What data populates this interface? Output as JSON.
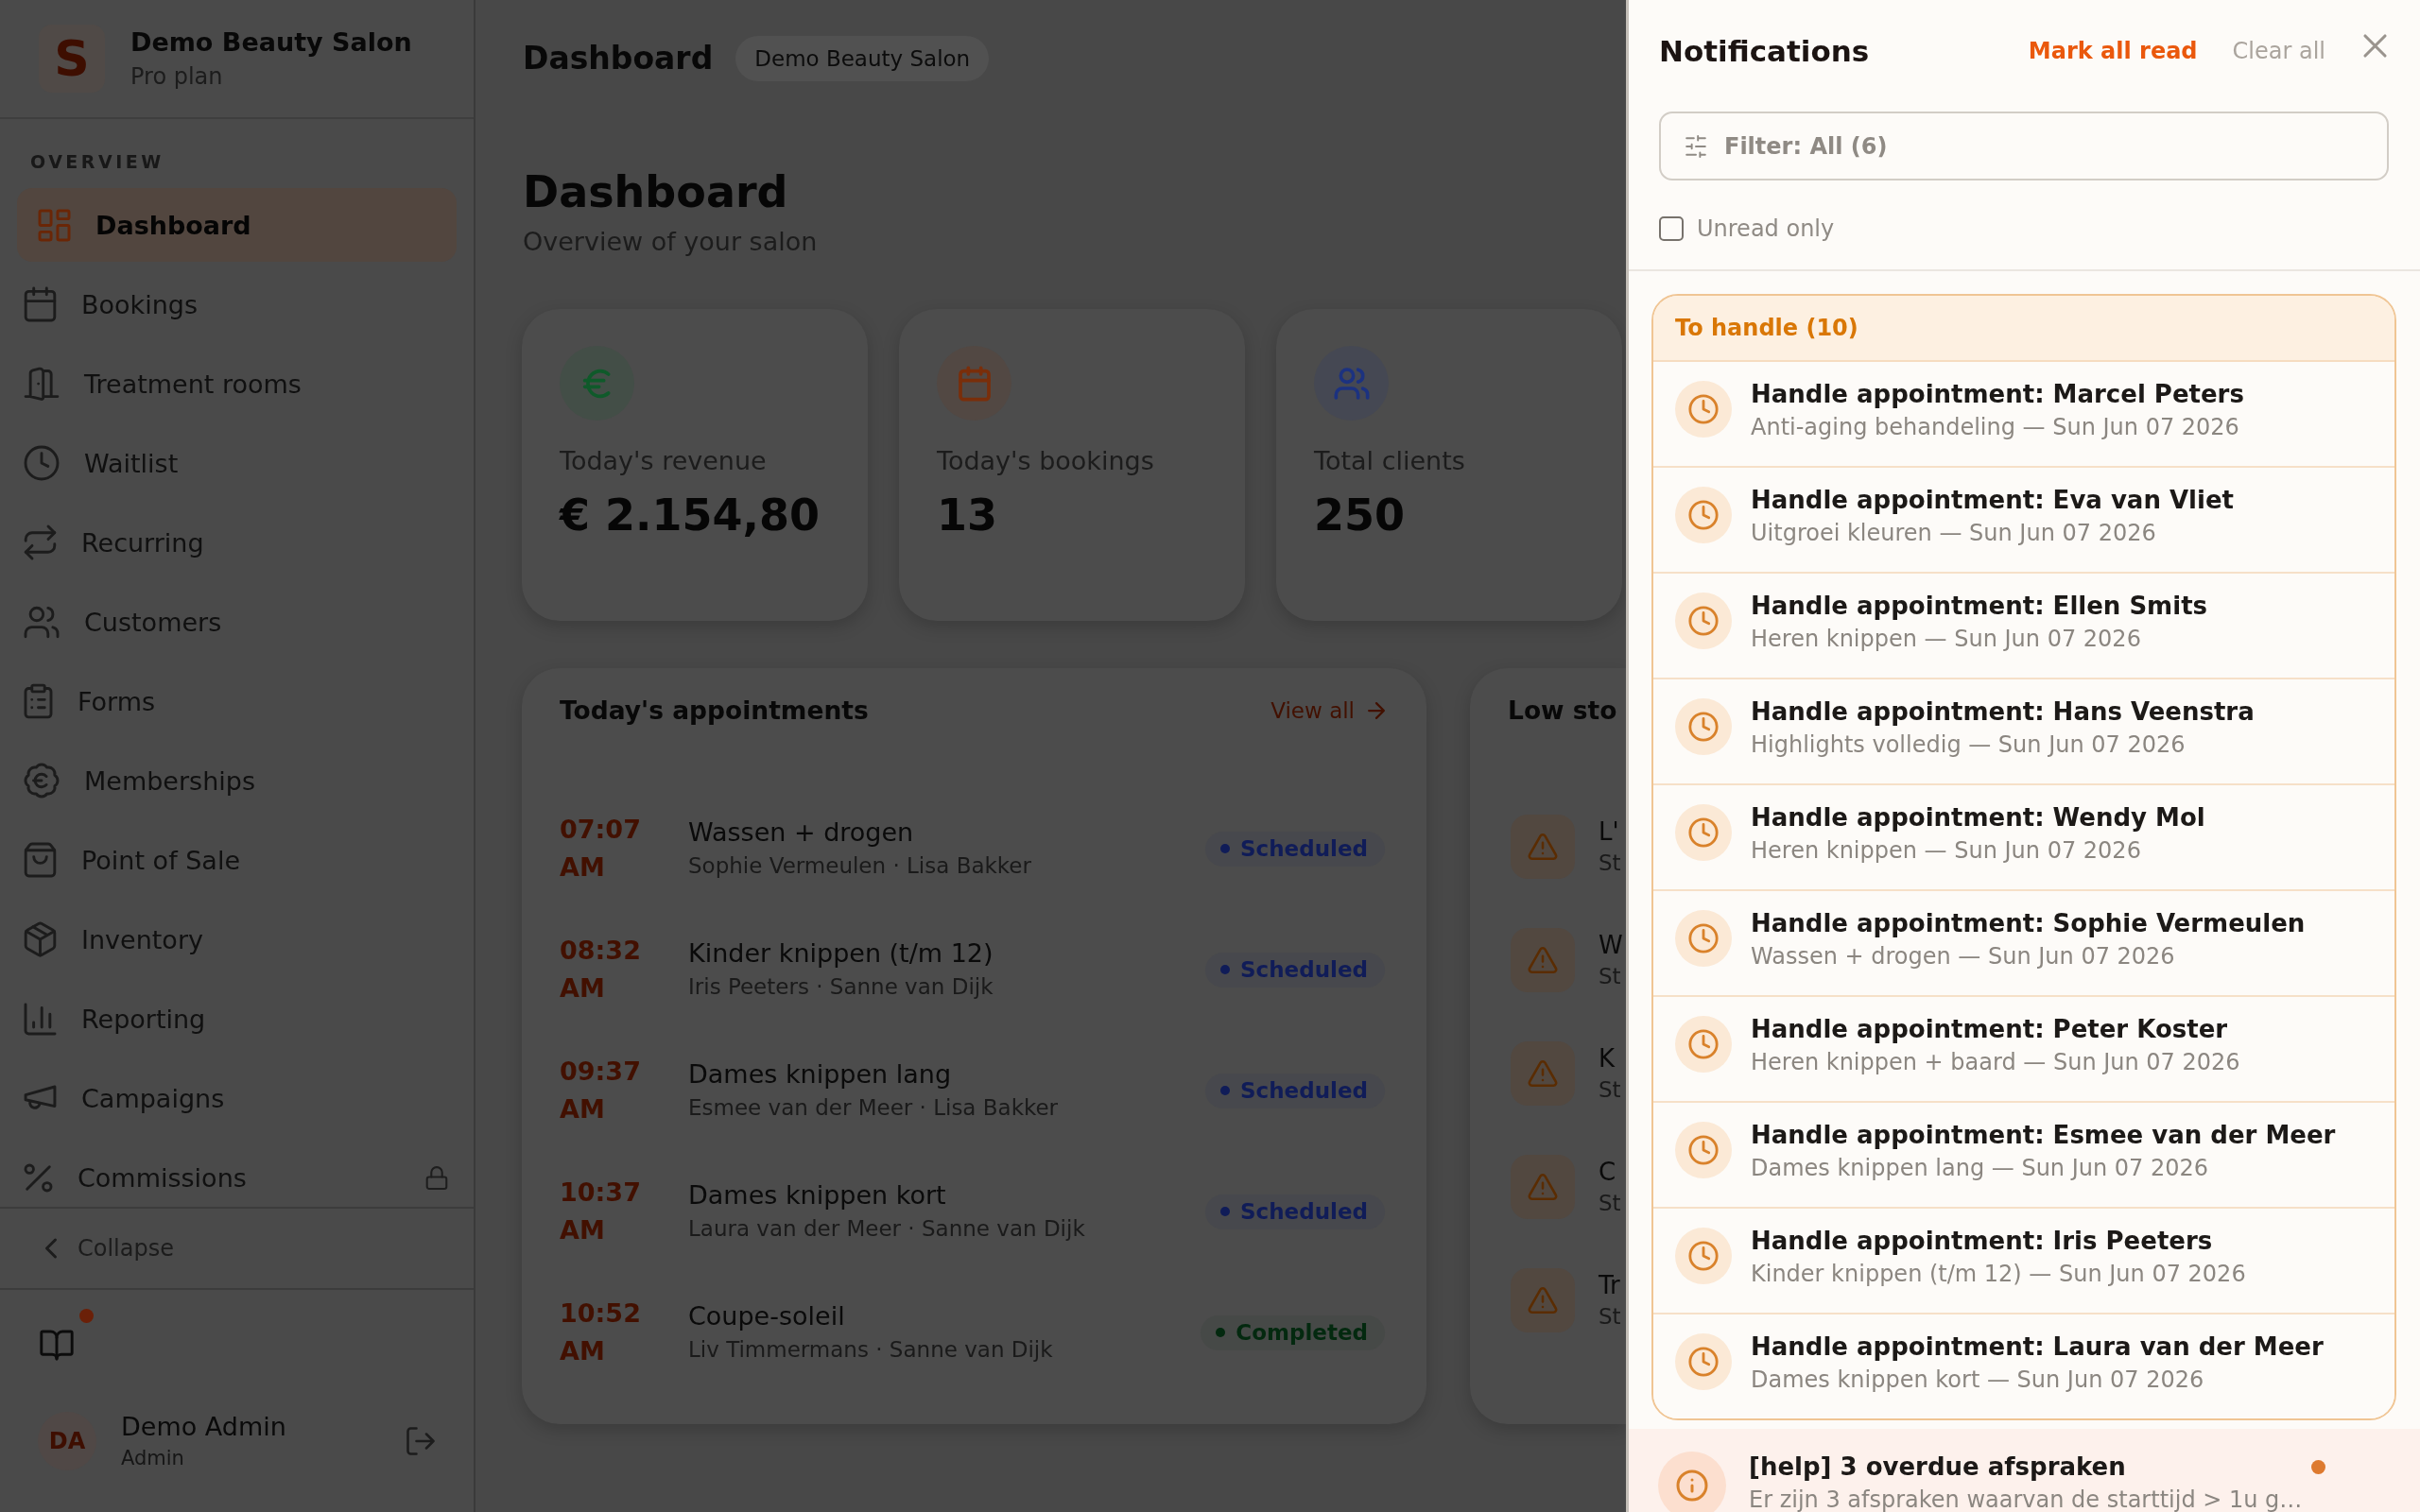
{
  "sidebar": {
    "brand": {
      "logo": "S",
      "name": "Demo Beauty Salon",
      "plan": "Pro plan"
    },
    "section": "OVERVIEW",
    "items": [
      {
        "label": "Dashboard",
        "selected": true,
        "locked": false
      },
      {
        "label": "Bookings",
        "selected": false,
        "locked": false
      },
      {
        "label": "Treatment rooms",
        "selected": false,
        "locked": false
      },
      {
        "label": "Waitlist",
        "selected": false,
        "locked": false
      },
      {
        "label": "Recurring",
        "selected": false,
        "locked": false
      },
      {
        "label": "Customers",
        "selected": false,
        "locked": false
      },
      {
        "label": "Forms",
        "selected": false,
        "locked": false
      },
      {
        "label": "Memberships",
        "selected": false,
        "locked": false
      },
      {
        "label": "Point of Sale",
        "selected": false,
        "locked": false
      },
      {
        "label": "Inventory",
        "selected": false,
        "locked": false
      },
      {
        "label": "Reporting",
        "selected": false,
        "locked": false
      },
      {
        "label": "Campaigns",
        "selected": false,
        "locked": false
      },
      {
        "label": "Commissions",
        "selected": false,
        "locked": true
      }
    ],
    "collapse": "Collapse",
    "help": {
      "unread": true
    },
    "user": {
      "initials": "DA",
      "name": "Demo Admin",
      "role": "Admin"
    }
  },
  "header": {
    "title": "Dashboard",
    "salon": "Demo Beauty Salon"
  },
  "page": {
    "title": "Dashboard",
    "subtitle": "Overview of your salon"
  },
  "stats": [
    {
      "label": "Today's revenue",
      "value": "€ 2.154,80",
      "color": "#0f5a2a"
    },
    {
      "label": "Today's bookings",
      "value": "13",
      "color": "#7a2e0a"
    },
    {
      "label": "Total clients",
      "value": "250",
      "color": "#1c3280"
    }
  ],
  "appointments": {
    "title": "Today's appointments",
    "link": "View all",
    "items": [
      {
        "time": "07:07 AM",
        "service": "Wassen + drogen",
        "detail": "Sophie Vermeulen · Lisa Bakker",
        "status": {
          "label": "Scheduled",
          "color": "#101c58"
        }
      },
      {
        "time": "08:32 AM",
        "service": "Kinder knippen (t/m 12)",
        "detail": "Iris Peeters · Sanne van Dijk",
        "status": {
          "label": "Scheduled",
          "color": "#101c58"
        }
      },
      {
        "time": "09:37 AM",
        "service": "Dames knippen lang",
        "detail": "Esmee van der Meer · Lisa Bakker",
        "status": {
          "label": "Scheduled",
          "color": "#101c58"
        }
      },
      {
        "time": "10:37 AM",
        "service": "Dames knippen kort",
        "detail": "Laura van der Meer · Sanne van Dijk",
        "status": {
          "label": "Scheduled",
          "color": "#101c58"
        }
      },
      {
        "time": "10:52 AM",
        "service": "Coupe-soleil",
        "detail": "Liv Timmermans · Sanne van Dijk",
        "status": {
          "label": "Completed",
          "color": "#03290f"
        }
      }
    ]
  },
  "low_stock": {
    "title": "Low sto",
    "items": [
      {
        "name": "L'",
        "detail": "St"
      },
      {
        "name": "W",
        "detail": "St"
      },
      {
        "name": "K",
        "detail": "St"
      },
      {
        "name": "C",
        "detail": "St"
      },
      {
        "name": "Tr",
        "detail": "St"
      }
    ]
  },
  "notifications": {
    "title": "Notifications",
    "mark_all_read": "Mark all read",
    "clear_all": "Clear all",
    "filter": "Filter: All (6)",
    "unread_only": {
      "label": "Unread only",
      "checked": false
    },
    "groups": [
      {
        "title": "To handle (10)",
        "items": [
          {
            "title": "Handle appointment: Marcel Peters",
            "subtitle": "Anti-aging behandeling — Sun Jun 07 2026",
            "unread": false
          },
          {
            "title": "Handle appointment: Eva van Vliet",
            "subtitle": "Uitgroei kleuren — Sun Jun 07 2026",
            "unread": false
          },
          {
            "title": "Handle appointment: Ellen Smits",
            "subtitle": "Heren knippen — Sun Jun 07 2026",
            "unread": false
          },
          {
            "title": "Handle appointment: Hans Veenstra",
            "subtitle": "Highlights volledig — Sun Jun 07 2026",
            "unread": false
          },
          {
            "title": "Handle appointment: Wendy Mol",
            "subtitle": "Heren knippen — Sun Jun 07 2026",
            "unread": false
          },
          {
            "title": "Handle appointment: Sophie Vermeulen",
            "subtitle": "Wassen + drogen — Sun Jun 07 2026",
            "unread": false
          },
          {
            "title": "Handle appointment: Peter Koster",
            "subtitle": "Heren knippen + baard — Sun Jun 07 2026",
            "unread": false
          },
          {
            "title": "Handle appointment: Esmee van der Meer",
            "subtitle": "Dames knippen lang — Sun Jun 07 2026",
            "unread": false
          },
          {
            "title": "Handle appointment: Iris Peeters",
            "subtitle": "Kinder knippen (t/m 12) — Sun Jun 07 2026",
            "unread": false
          },
          {
            "title": "Handle appointment: Laura van der Meer",
            "subtitle": "Dames knippen kort — Sun Jun 07 2026",
            "unread": false
          }
        ]
      }
    ],
    "items": [
      {
        "title": "[help] 3 overdue afspraken",
        "subtitle": "Er zijn 3 afspraken waarvan de starttijd > 1u g…",
        "unread": true
      }
    ]
  }
}
